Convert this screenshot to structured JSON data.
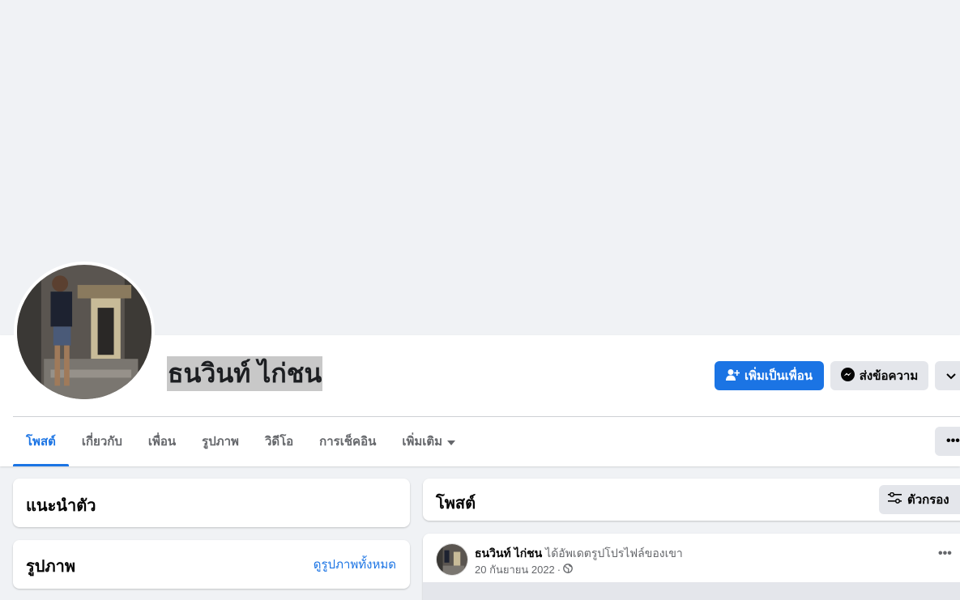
{
  "profile": {
    "name": "ธนวินท์ ไก่ชน",
    "add_friend_label": "เพิ่มเป็นเพื่อน",
    "message_label": "ส่งข้อความ"
  },
  "tabs": [
    {
      "label": "โพสต์"
    },
    {
      "label": "เกี่ยวกับ"
    },
    {
      "label": "เพื่อน"
    },
    {
      "label": "รูปภาพ"
    },
    {
      "label": "วิดีโอ"
    },
    {
      "label": "การเช็คอิน"
    },
    {
      "label": "เพิ่มเติม"
    }
  ],
  "intro": {
    "title": "แนะนำตัว"
  },
  "photos": {
    "title": "รูปภาพ",
    "see_all": "ดูรูปภาพทั้งหมด"
  },
  "posts": {
    "title": "โพสต์",
    "filter_label": "ตัวกรอง"
  },
  "post": {
    "author": "ธนวินท์ ไก่ชน",
    "action": "ได้อัพเดตรูปโปรไฟล์ของเขา",
    "date": "20 กันยายน 2022",
    "separator": "·"
  },
  "colors": {
    "accent": "#1b74e4",
    "page_bg": "#f0f2f5",
    "secondary_btn": "#e4e6eb"
  },
  "icons": [
    "add-friend-icon",
    "messenger-icon",
    "chevron-down-icon",
    "caret-down-icon",
    "more-dots-icon",
    "filter-icon",
    "globe-icon"
  ]
}
